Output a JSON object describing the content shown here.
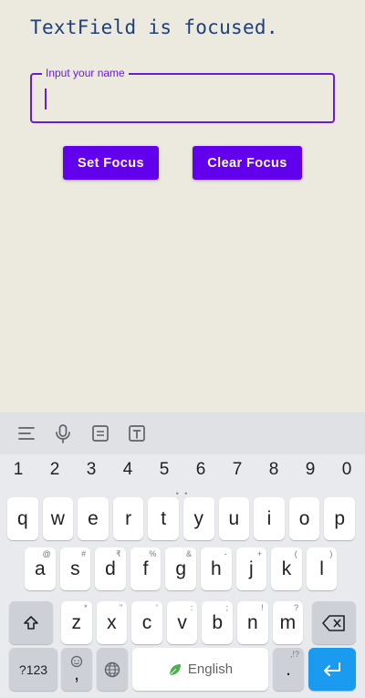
{
  "status": {
    "text": "TextField is focused."
  },
  "name_field": {
    "label": "Input your name",
    "value": ""
  },
  "buttons": {
    "set_focus": "Set Focus",
    "clear_focus": "Clear Focus"
  },
  "colors": {
    "accent": "#6200EE",
    "outline": "#6A1BD6",
    "status_text": "#1F3F7A",
    "enter_key": "#1A9BF0"
  },
  "keyboard": {
    "toolbar_icons": [
      "menu-icon",
      "microphone-icon",
      "clipboard-icon",
      "text-icon"
    ],
    "numbers": [
      "1",
      "2",
      "3",
      "4",
      "5",
      "6",
      "7",
      "8",
      "9",
      "0"
    ],
    "row1": [
      {
        "k": "q",
        "h": ""
      },
      {
        "k": "w",
        "h": ""
      },
      {
        "k": "e",
        "h": ""
      },
      {
        "k": "r",
        "h": ""
      },
      {
        "k": "t",
        "h": ""
      },
      {
        "k": "y",
        "h": ""
      },
      {
        "k": "u",
        "h": ""
      },
      {
        "k": "i",
        "h": ""
      },
      {
        "k": "o",
        "h": ""
      },
      {
        "k": "p",
        "h": ""
      }
    ],
    "row2": [
      {
        "k": "a",
        "h": "@"
      },
      {
        "k": "s",
        "h": "#"
      },
      {
        "k": "d",
        "h": "₹"
      },
      {
        "k": "f",
        "h": "%"
      },
      {
        "k": "g",
        "h": "&"
      },
      {
        "k": "h",
        "h": "-"
      },
      {
        "k": "j",
        "h": "+"
      },
      {
        "k": "k",
        "h": "("
      },
      {
        "k": "l",
        "h": ")"
      }
    ],
    "row3": [
      {
        "k": "z",
        "h": "*"
      },
      {
        "k": "x",
        "h": "\""
      },
      {
        "k": "c",
        "h": "'"
      },
      {
        "k": "v",
        "h": ":"
      },
      {
        "k": "b",
        "h": ";"
      },
      {
        "k": "n",
        "h": "!"
      },
      {
        "k": "m",
        "h": "?"
      }
    ],
    "symbols_key": "?123",
    "comma_key": ",",
    "space_label": "English",
    "period_key": ".",
    "period_hint": ",!?"
  }
}
